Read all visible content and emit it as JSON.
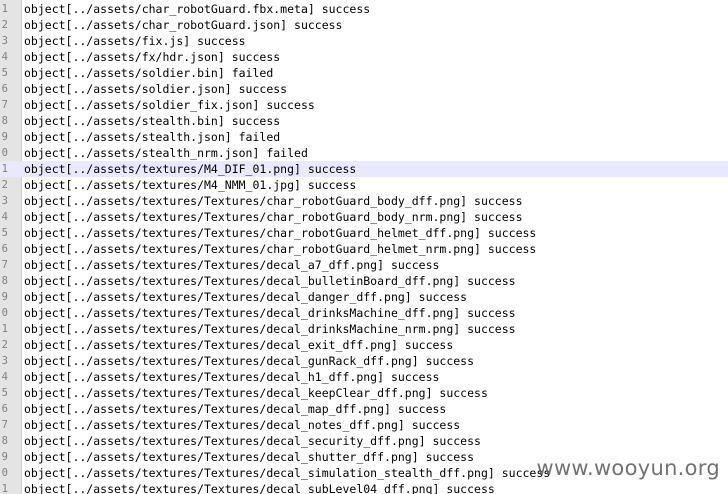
{
  "editor": {
    "lines": [
      {
        "num": "1",
        "text": "object[../assets/char_robotGuard.fbx.meta] success"
      },
      {
        "num": "2",
        "text": "object[../assets/char_robotGuard.json] success"
      },
      {
        "num": "3",
        "text": "object[../assets/fix.js] success"
      },
      {
        "num": "4",
        "text": "object[../assets/fx/hdr.json] success"
      },
      {
        "num": "5",
        "text": "object[../assets/soldier.bin] failed"
      },
      {
        "num": "6",
        "text": "object[../assets/soldier.json] success"
      },
      {
        "num": "7",
        "text": "object[../assets/soldier_fix.json] success"
      },
      {
        "num": "8",
        "text": "object[../assets/stealth.bin] success"
      },
      {
        "num": "9",
        "text": "object[../assets/stealth.json] failed"
      },
      {
        "num": "0",
        "text": "object[../assets/stealth_nrm.json] failed"
      },
      {
        "num": "1",
        "text": "object[../assets/textures/M4_DIF_01.png] success"
      },
      {
        "num": "2",
        "text": "object[../assets/textures/M4_NMM_01.jpg] success"
      },
      {
        "num": "3",
        "text": "object[../assets/textures/Textures/char_robotGuard_body_dff.png] success"
      },
      {
        "num": "4",
        "text": "object[../assets/textures/Textures/char_robotGuard_body_nrm.png] success"
      },
      {
        "num": "5",
        "text": "object[../assets/textures/Textures/char_robotGuard_helmet_dff.png] success"
      },
      {
        "num": "6",
        "text": "object[../assets/textures/Textures/char_robotGuard_helmet_nrm.png] success"
      },
      {
        "num": "7",
        "text": "object[../assets/textures/Textures/decal_a7_dff.png] success"
      },
      {
        "num": "8",
        "text": "object[../assets/textures/Textures/decal_bulletinBoard_dff.png] success"
      },
      {
        "num": "9",
        "text": "object[../assets/textures/Textures/decal_danger_dff.png] success"
      },
      {
        "num": "0",
        "text": "object[../assets/textures/Textures/decal_drinksMachine_dff.png] success"
      },
      {
        "num": "1",
        "text": "object[../assets/textures/Textures/decal_drinksMachine_nrm.png] success"
      },
      {
        "num": "2",
        "text": "object[../assets/textures/Textures/decal_exit_dff.png] success"
      },
      {
        "num": "3",
        "text": "object[../assets/textures/Textures/decal_gunRack_dff.png] success"
      },
      {
        "num": "4",
        "text": "object[../assets/textures/Textures/decal_h1_dff.png] success"
      },
      {
        "num": "5",
        "text": "object[../assets/textures/Textures/decal_keepClear_dff.png] success"
      },
      {
        "num": "6",
        "text": "object[../assets/textures/Textures/decal_map_dff.png] success"
      },
      {
        "num": "7",
        "text": "object[../assets/textures/Textures/decal_notes_dff.png] success"
      },
      {
        "num": "8",
        "text": "object[../assets/textures/Textures/decal_security_dff.png] success"
      },
      {
        "num": "9",
        "text": "object[../assets/textures/Textures/decal_shutter_dff.png] success"
      },
      {
        "num": "0",
        "text": "object[../assets/textures/Textures/decal_simulation_stealth_dff.png] success"
      },
      {
        "num": "1",
        "text": "object[../assets/textures/Textures/decal_subLevel04_dff.png] success"
      }
    ],
    "current_line_index": 10
  },
  "watermark": "www.wooyun.org",
  "colors": {
    "gutter": "#e4e4e4",
    "current_line": "#e8e8ff",
    "text": "#000000",
    "line_number": "#808080"
  }
}
